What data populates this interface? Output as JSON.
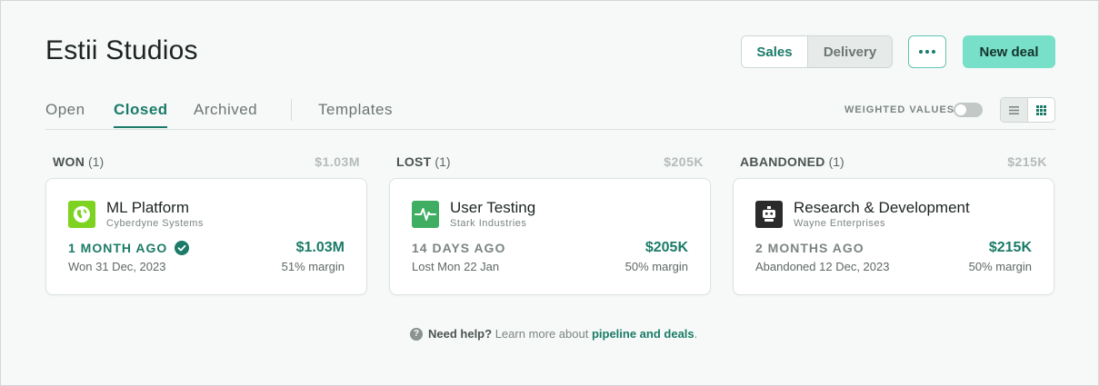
{
  "header": {
    "title": "Estii Studios",
    "segment": [
      "Sales",
      "Delivery"
    ],
    "new_deal_label": "New deal"
  },
  "tabs": [
    "Open",
    "Closed",
    "Archived",
    "Templates"
  ],
  "active_tab": "Closed",
  "weighted_values_label": "WEIGHTED VALUES",
  "weighted_values_on": false,
  "view_mode": "grid",
  "columns": [
    {
      "status": "WON",
      "count": "(1)",
      "total": "$1.03M",
      "card": {
        "name": "ML Platform",
        "company": "Cyberdyne Systems",
        "ago": "1 MONTH AGO",
        "date": "Won 31 Dec, 2023",
        "amount": "$1.03M",
        "margin": "51% margin",
        "logo_icon": "globe-icon",
        "logo_color": "#7ed321"
      }
    },
    {
      "status": "LOST",
      "count": "(1)",
      "total": "$205K",
      "card": {
        "name": "User Testing",
        "company": "Stark Industries",
        "ago": "14 DAYS AGO",
        "date": "Lost Mon 22 Jan",
        "amount": "$205K",
        "margin": "50% margin",
        "logo_icon": "pulse-icon",
        "logo_color": "#3fae62"
      }
    },
    {
      "status": "ABANDONED",
      "count": "(1)",
      "total": "$215K",
      "card": {
        "name": "Research & Development",
        "company": "Wayne Enterprises",
        "ago": "2 MONTHS AGO",
        "date": "Abandoned 12 Dec, 2023",
        "amount": "$215K",
        "margin": "50% margin",
        "logo_icon": "robot-icon",
        "logo_color": "#2b2b2b"
      }
    }
  ],
  "help": {
    "lead": "Need help?",
    "text": "Learn more about",
    "link": "pipeline and deals",
    "end": "."
  },
  "colors": {
    "accent": "#1b7b68",
    "primary_button": "#78e0c9"
  }
}
